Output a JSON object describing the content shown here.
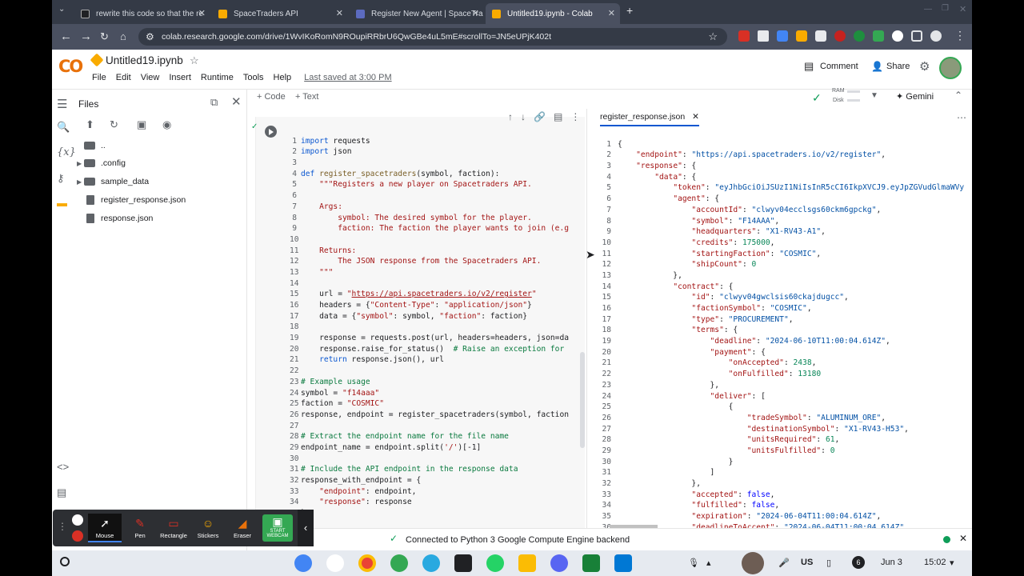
{
  "tabs": [
    {
      "label": "rewrite this code so that the re",
      "favicon_color": "#202124"
    },
    {
      "label": "SpaceTraders API",
      "favicon_color": "#f9ab00"
    },
    {
      "label": "Register New Agent | SpaceTra",
      "favicon_color": "#5c6bc0"
    },
    {
      "label": "Untitled19.ipynb - Colab",
      "favicon_color": "#f9ab00"
    }
  ],
  "browser": {
    "url": "colab.research.google.com/drive/1WvIKoRomN9ROupiRRbrU6QwGBe4uL5mE#scrollTo=JN5eUPjK402t"
  },
  "colab": {
    "logo": "CO",
    "notebook_title": "Untitled19.ipynb",
    "menu": [
      "File",
      "Edit",
      "View",
      "Insert",
      "Runtime",
      "Tools",
      "Help"
    ],
    "last_saved": "Last saved at 3:00 PM",
    "comment": "Comment",
    "share": "Share",
    "add_code": "+ Code",
    "add_text": "+ Text",
    "ram_label": "RAM",
    "disk_label": "Disk",
    "gemini": "Gemini"
  },
  "files": {
    "title": "Files",
    "items": [
      {
        "name": "..",
        "type": "folder"
      },
      {
        "name": ".config",
        "type": "folder"
      },
      {
        "name": "sample_data",
        "type": "folder"
      },
      {
        "name": "register_response.json",
        "type": "file"
      },
      {
        "name": "response.json",
        "type": "file"
      }
    ]
  },
  "json_tab": "register_response.json",
  "status": "Connected to Python 3 Google Compute Engine backend",
  "recorder": {
    "tools": [
      "Mouse",
      "Pen",
      "Rectangle",
      "Stickers",
      "Eraser",
      "START WEBCAM"
    ]
  },
  "taskbar": {
    "locale": "US",
    "notifications": "6",
    "date": "Jun 3",
    "time": "15:02"
  }
}
